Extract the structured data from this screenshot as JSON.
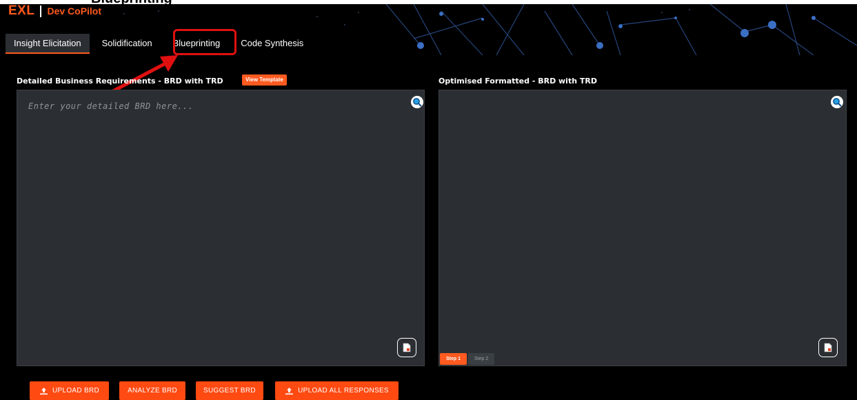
{
  "caption": {
    "text": "Blueprinting"
  },
  "brand": {
    "logo": "EXL",
    "product": "Dev CoPilot"
  },
  "tabs": [
    {
      "label": "Insight Elicitation",
      "active": true
    },
    {
      "label": "Solidification",
      "active": false
    },
    {
      "label": "Blueprinting",
      "active": false,
      "highlighted": true
    },
    {
      "label": "Code Synthesis",
      "active": false
    }
  ],
  "left_panel": {
    "title": "Detailed Business Requirements - BRD with TRD",
    "view_template_label": "View Template",
    "placeholder": "Enter your detailed BRD here...",
    "search_icon": "search-icon",
    "doc_icon": "document-icon"
  },
  "right_panel": {
    "title": "Optimised Formatted - BRD with TRD",
    "steps": [
      {
        "label": "Step 1",
        "active": true
      },
      {
        "label": "Step 2",
        "active": false
      }
    ],
    "search_icon": "search-icon",
    "doc_icon": "document-icon"
  },
  "actions": {
    "upload_brd": "UPLOAD BRD",
    "analyze_brd": "ANALYZE BRD",
    "suggest_brd": "SUGGEST BRD",
    "upload_all": "UPLOAD ALL RESPONSES"
  },
  "colors": {
    "accent": "#ff5a1f",
    "panel": "#2b2f33",
    "background": "#000000",
    "highlight": "#e01010"
  }
}
